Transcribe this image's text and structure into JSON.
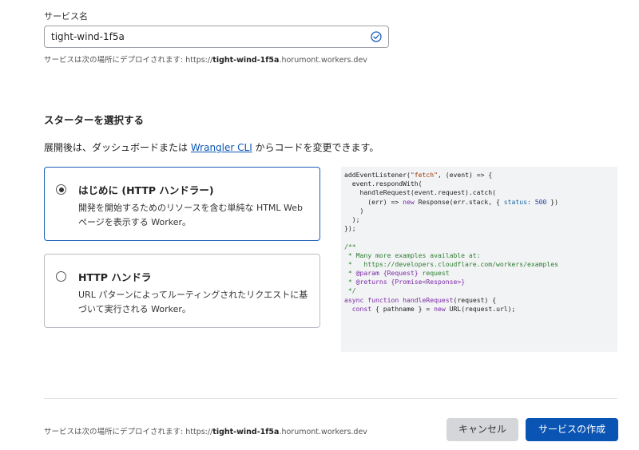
{
  "service_name": {
    "label": "サービス名",
    "value": "tight-wind-1f5a",
    "valid_icon": "check-circle-icon",
    "deploy_hint_prefix": "サービスは次の場所にデプロイされます: https://",
    "deploy_hint_name": "tight-wind-1f5a",
    "deploy_hint_suffix": ".horumont.workers.dev"
  },
  "starter": {
    "title": "スターターを選択する",
    "desc_prefix": "展開後は、ダッシュボードまたは ",
    "desc_link": "Wrangler CLI",
    "desc_suffix": " からコードを変更できます。",
    "options": [
      {
        "title": "はじめに (HTTP ハンドラー)",
        "desc": "開発を開始するためのリソースを含む単純な HTML Web ページを表示する Worker。",
        "selected": true
      },
      {
        "title": "HTTP ハンドラ",
        "desc": "URL パターンによってルーティングされたリクエストに基づいて実行される Worker。",
        "selected": false
      }
    ]
  },
  "code": {
    "lines": [
      "addEventListener(\"fetch\", (event) => {",
      "  event.respondWith(",
      "    handleRequest(event.request).catch(",
      "      (err) => new Response(err.stack, { status: 500 })",
      "    )",
      "  );",
      "});",
      "",
      "/**",
      " * Many more examples available at:",
      " *   https://developers.cloudflare.com/workers/examples",
      " * @param {Request} request",
      " * @returns {Promise<Response>}",
      " */",
      "async function handleRequest(request) {",
      "  const { pathname } = new URL(request.url);"
    ]
  },
  "footer": {
    "deploy_hint_prefix": "サービスは次の場所にデプロイされます: https://",
    "deploy_hint_name": "tight-wind-1f5a",
    "deploy_hint_suffix": ".horumont.workers.dev",
    "cancel_label": "キャンセル",
    "create_label": "サービスの作成"
  },
  "colors": {
    "accent": "#0a55b3",
    "selected_border": "#1a5fb4",
    "code_bg": "#f2f3f4",
    "cancel_bg": "#d4d6d9"
  }
}
